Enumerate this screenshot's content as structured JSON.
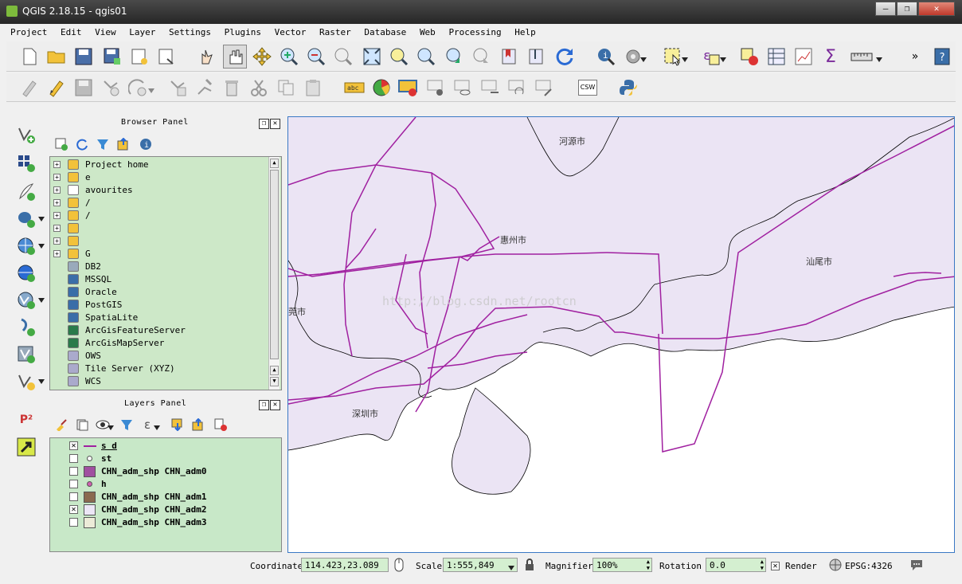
{
  "window": {
    "title": "QGIS 2.18.15 - qgis01",
    "controls": [
      "–",
      "❐",
      "✕"
    ]
  },
  "menu": [
    "Project",
    "Edit",
    "View",
    "Layer",
    "Settings",
    "Plugins",
    "Vector",
    "Raster",
    "Database",
    "Web",
    "Processing",
    "Help"
  ],
  "toolbar": {
    "overflow": "»",
    "csw_label": "CSW",
    "sum_label": "Σ",
    "label_abc": "abc",
    "label_ab": "ab"
  },
  "browser": {
    "title": "Browser Panel",
    "items": [
      {
        "label": "Project home",
        "icon": "folder-icon"
      },
      {
        "label": "e",
        "icon": "folder-icon"
      },
      {
        "label": "avourites",
        "icon": "star-icon"
      },
      {
        "label": "/",
        "icon": "folder-icon"
      },
      {
        "label": "/",
        "icon": "folder-icon"
      },
      {
        "label": "",
        "icon": "folder-icon"
      },
      {
        "label": "",
        "icon": "folder-icon"
      },
      {
        "label": "G",
        "icon": "folder-icon"
      },
      {
        "label": "DB2",
        "icon": "db2-icon"
      },
      {
        "label": "MSSQL",
        "icon": "mssql-icon"
      },
      {
        "label": "Oracle",
        "icon": "oracle-icon"
      },
      {
        "label": "PostGIS",
        "icon": "postgis-icon"
      },
      {
        "label": "SpatiaLite",
        "icon": "spatialite-icon"
      },
      {
        "label": "ArcGisFeatureServer",
        "icon": "arcgis-icon"
      },
      {
        "label": "ArcGisMapServer",
        "icon": "arcgis-icon"
      },
      {
        "label": "OWS",
        "icon": "globe-icon"
      },
      {
        "label": "Tile Server (XYZ)",
        "icon": "globe-icon"
      },
      {
        "label": "WCS",
        "icon": "globe-icon"
      }
    ]
  },
  "layers": {
    "title": "Layers Panel",
    "items": [
      {
        "label": "s           d",
        "checked": true,
        "symbol": "line",
        "color": "#a020a0"
      },
      {
        "label": "st",
        "checked": false,
        "symbol": "point",
        "color": "#ffffff"
      },
      {
        "label": "CHN_adm_shp CHN_adm0",
        "checked": false,
        "symbol": "fill",
        "color": "#a050a0"
      },
      {
        "label": "h",
        "checked": false,
        "symbol": "point",
        "color": "#d060b0"
      },
      {
        "label": "CHN_adm_shp CHN_adm1",
        "checked": false,
        "symbol": "fill",
        "color": "#8a6a50"
      },
      {
        "label": "CHN_adm_shp CHN_adm2",
        "checked": true,
        "symbol": "fill",
        "color": "#ece6f6"
      },
      {
        "label": "CHN_adm_shp CHN_adm3",
        "checked": false,
        "symbol": "fill",
        "color": "#ecebd8"
      }
    ]
  },
  "map": {
    "labels": [
      "河源市",
      "惠州市",
      "汕尾市",
      "莞市",
      "深圳市"
    ],
    "watermark": "http://blog.csdn.net/rootcn",
    "land_color": "#ebe4f4",
    "route_color": "#a020a0"
  },
  "status": {
    "coordinate_label": "Coordinate",
    "coordinate_value": "114.423,23.089",
    "scale_label": "Scale",
    "scale_value": "1:555,849",
    "magnifier_label": "Magnifier",
    "magnifier_value": "100%",
    "rotation_label": "Rotation",
    "rotation_value": "0.0",
    "render_label": "Render",
    "render_checked": true,
    "crs_label": "EPSG:4326"
  }
}
